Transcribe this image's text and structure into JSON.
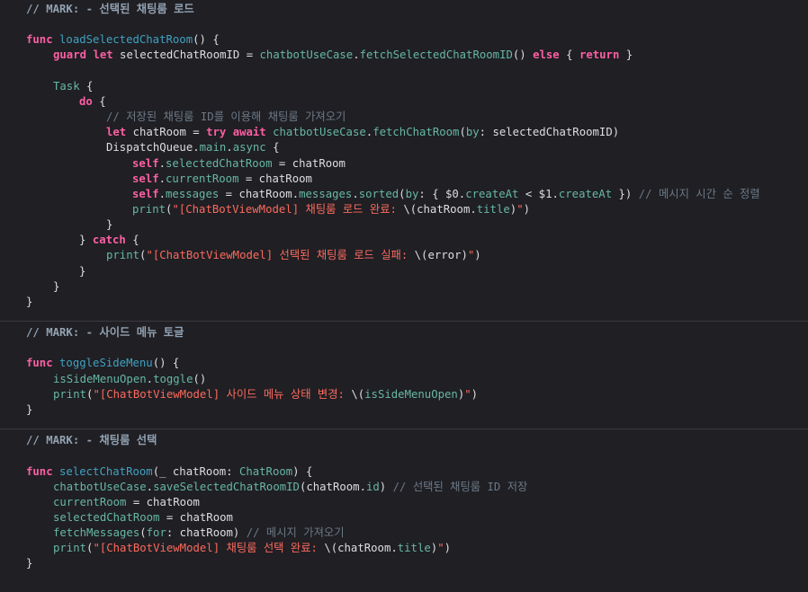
{
  "editor": {
    "theme": {
      "background": "#1f1f24",
      "plain": "#dfdfe0",
      "keyword": "#fc5fa3",
      "declaration": "#41a1c0",
      "project_symbol": "#67b7a4",
      "string": "#fc6a5d",
      "comment": "#6c7986",
      "mark": "#92a1b1"
    },
    "lines": [
      {
        "row": 0,
        "indent": 0,
        "tokens": [
          [
            "mark",
            "// MARK: - 선택된 채팅룸 로드"
          ]
        ]
      },
      {
        "row": 2,
        "indent": 0,
        "tokens": [
          [
            "kw",
            "func"
          ],
          [
            "txt",
            " "
          ],
          [
            "decl",
            "loadSelectedChatRoom"
          ],
          [
            "txt",
            "() {"
          ]
        ]
      },
      {
        "row": 3,
        "indent": 1,
        "tokens": [
          [
            "kw",
            "guard"
          ],
          [
            "txt",
            " "
          ],
          [
            "kw",
            "let"
          ],
          [
            "txt",
            " selectedChatRoomID = "
          ],
          [
            "call",
            "chatbotUseCase"
          ],
          [
            "txt",
            "."
          ],
          [
            "call",
            "fetchSelectedChatRoomID"
          ],
          [
            "txt",
            "() "
          ],
          [
            "kw",
            "else"
          ],
          [
            "txt",
            " { "
          ],
          [
            "kw",
            "return"
          ],
          [
            "txt",
            " }"
          ]
        ]
      },
      {
        "row": 5,
        "indent": 1,
        "tokens": [
          [
            "call",
            "Task"
          ],
          [
            "txt",
            " {"
          ]
        ]
      },
      {
        "row": 6,
        "indent": 2,
        "tokens": [
          [
            "kw",
            "do"
          ],
          [
            "txt",
            " {"
          ]
        ]
      },
      {
        "row": 7,
        "indent": 3,
        "tokens": [
          [
            "cmt",
            "// 저장된 채팅룸 ID를 이용해 채팅룸 가져오기"
          ]
        ]
      },
      {
        "row": 8,
        "indent": 3,
        "tokens": [
          [
            "kw",
            "let"
          ],
          [
            "txt",
            " chatRoom = "
          ],
          [
            "kw",
            "try"
          ],
          [
            "txt",
            " "
          ],
          [
            "kw",
            "await"
          ],
          [
            "txt",
            " "
          ],
          [
            "call",
            "chatbotUseCase"
          ],
          [
            "txt",
            "."
          ],
          [
            "call",
            "fetchChatRoom"
          ],
          [
            "txt",
            "("
          ],
          [
            "call",
            "by"
          ],
          [
            "txt",
            ": selectedChatRoomID)"
          ]
        ]
      },
      {
        "row": 9,
        "indent": 3,
        "tokens": [
          [
            "txt",
            "DispatchQueue."
          ],
          [
            "call",
            "main"
          ],
          [
            "txt",
            "."
          ],
          [
            "call",
            "async"
          ],
          [
            "txt",
            " {"
          ]
        ]
      },
      {
        "row": 10,
        "indent": 4,
        "tokens": [
          [
            "kw",
            "self"
          ],
          [
            "txt",
            "."
          ],
          [
            "call",
            "selectedChatRoom"
          ],
          [
            "txt",
            " = chatRoom"
          ]
        ]
      },
      {
        "row": 11,
        "indent": 4,
        "tokens": [
          [
            "kw",
            "self"
          ],
          [
            "txt",
            "."
          ],
          [
            "call",
            "currentRoom"
          ],
          [
            "txt",
            " = chatRoom"
          ]
        ]
      },
      {
        "row": 12,
        "indent": 4,
        "tokens": [
          [
            "kw",
            "self"
          ],
          [
            "txt",
            "."
          ],
          [
            "call",
            "messages"
          ],
          [
            "txt",
            " = chatRoom."
          ],
          [
            "call",
            "messages"
          ],
          [
            "txt",
            "."
          ],
          [
            "call",
            "sorted"
          ],
          [
            "txt",
            "("
          ],
          [
            "call",
            "by"
          ],
          [
            "txt",
            ": { $0."
          ],
          [
            "call",
            "createAt"
          ],
          [
            "txt",
            " < $1."
          ],
          [
            "call",
            "createAt"
          ],
          [
            "txt",
            " }) "
          ],
          [
            "cmt",
            "// 메시지 시간 순 정렬"
          ]
        ]
      },
      {
        "row": 13,
        "indent": 4,
        "tokens": [
          [
            "call",
            "print"
          ],
          [
            "txt",
            "("
          ],
          [
            "str",
            "\"[ChatBotViewModel] 채팅룸 로드 완료: "
          ],
          [
            "txt",
            "\\(chatRoom."
          ],
          [
            "call",
            "title"
          ],
          [
            "txt",
            ")"
          ],
          [
            "str",
            "\""
          ],
          [
            "txt",
            ")"
          ]
        ]
      },
      {
        "row": 14,
        "indent": 3,
        "tokens": [
          [
            "txt",
            "}"
          ]
        ]
      },
      {
        "row": 15,
        "indent": 2,
        "tokens": [
          [
            "txt",
            "} "
          ],
          [
            "kw",
            "catch"
          ],
          [
            "txt",
            " {"
          ]
        ]
      },
      {
        "row": 16,
        "indent": 3,
        "tokens": [
          [
            "call",
            "print"
          ],
          [
            "txt",
            "("
          ],
          [
            "str",
            "\"[ChatBotViewModel] 선택된 채팅룸 로드 실패: "
          ],
          [
            "txt",
            "\\(error)"
          ],
          [
            "str",
            "\""
          ],
          [
            "txt",
            ")"
          ]
        ]
      },
      {
        "row": 17,
        "indent": 2,
        "tokens": [
          [
            "txt",
            "}"
          ]
        ]
      },
      {
        "row": 18,
        "indent": 1,
        "tokens": [
          [
            "txt",
            "}"
          ]
        ]
      },
      {
        "row": 19,
        "indent": 0,
        "tokens": [
          [
            "txt",
            "}"
          ]
        ]
      },
      {
        "row": 21,
        "indent": 0,
        "tokens": [
          [
            "mark",
            "// MARK: - 사이드 메뉴 토글"
          ]
        ]
      },
      {
        "row": 23,
        "indent": 0,
        "tokens": [
          [
            "kw",
            "func"
          ],
          [
            "txt",
            " "
          ],
          [
            "decl",
            "toggleSideMenu"
          ],
          [
            "txt",
            "() {"
          ]
        ]
      },
      {
        "row": 24,
        "indent": 1,
        "tokens": [
          [
            "call",
            "isSideMenuOpen"
          ],
          [
            "txt",
            "."
          ],
          [
            "call",
            "toggle"
          ],
          [
            "txt",
            "()"
          ]
        ]
      },
      {
        "row": 25,
        "indent": 1,
        "tokens": [
          [
            "call",
            "print"
          ],
          [
            "txt",
            "("
          ],
          [
            "str",
            "\"[ChatBotViewModel] 사이드 메뉴 상태 변경: "
          ],
          [
            "txt",
            "\\("
          ],
          [
            "call",
            "isSideMenuOpen"
          ],
          [
            "txt",
            ")"
          ],
          [
            "str",
            "\""
          ],
          [
            "txt",
            ")"
          ]
        ]
      },
      {
        "row": 26,
        "indent": 0,
        "tokens": [
          [
            "txt",
            "}"
          ]
        ]
      },
      {
        "row": 28,
        "indent": 0,
        "tokens": [
          [
            "mark",
            "// MARK: - 채팅룸 선택"
          ]
        ]
      },
      {
        "row": 30,
        "indent": 0,
        "tokens": [
          [
            "kw",
            "func"
          ],
          [
            "txt",
            " "
          ],
          [
            "decl",
            "selectChatRoom"
          ],
          [
            "txt",
            "(_ chatRoom: "
          ],
          [
            "call",
            "ChatRoom"
          ],
          [
            "txt",
            ") {"
          ]
        ]
      },
      {
        "row": 31,
        "indent": 1,
        "tokens": [
          [
            "call",
            "chatbotUseCase"
          ],
          [
            "txt",
            "."
          ],
          [
            "call",
            "saveSelectedChatRoomID"
          ],
          [
            "txt",
            "(chatRoom."
          ],
          [
            "call",
            "id"
          ],
          [
            "txt",
            ") "
          ],
          [
            "cmt",
            "// 선택된 채팅룸 ID 저장"
          ]
        ]
      },
      {
        "row": 32,
        "indent": 1,
        "tokens": [
          [
            "call",
            "currentRoom"
          ],
          [
            "txt",
            " = chatRoom"
          ]
        ]
      },
      {
        "row": 33,
        "indent": 1,
        "tokens": [
          [
            "call",
            "selectedChatRoom"
          ],
          [
            "txt",
            " = chatRoom"
          ]
        ]
      },
      {
        "row": 34,
        "indent": 1,
        "tokens": [
          [
            "call",
            "fetchMessages"
          ],
          [
            "txt",
            "("
          ],
          [
            "call",
            "for"
          ],
          [
            "txt",
            ": chatRoom) "
          ],
          [
            "cmt",
            "// 메시지 가져오기"
          ]
        ]
      },
      {
        "row": 35,
        "indent": 1,
        "tokens": [
          [
            "call",
            "print"
          ],
          [
            "txt",
            "("
          ],
          [
            "str",
            "\"[ChatBotViewModel] 채팅룸 선택 완료: "
          ],
          [
            "txt",
            "\\(chatRoom."
          ],
          [
            "call",
            "title"
          ],
          [
            "txt",
            ")"
          ],
          [
            "str",
            "\""
          ],
          [
            "txt",
            ")"
          ]
        ]
      },
      {
        "row": 36,
        "indent": 0,
        "tokens": [
          [
            "txt",
            "}"
          ]
        ]
      }
    ],
    "dividers_before_rows": [
      21,
      28
    ]
  }
}
